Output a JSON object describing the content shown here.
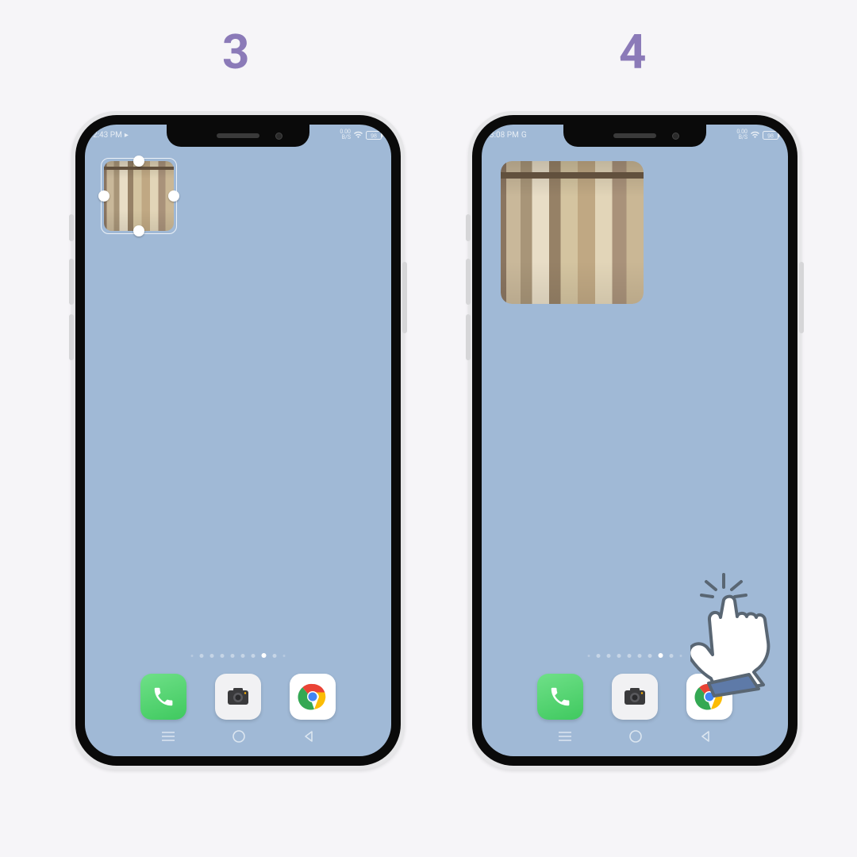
{
  "steps": {
    "left": {
      "label": "3"
    },
    "right": {
      "label": "4"
    }
  },
  "phone_left": {
    "status": {
      "time": "2:43 PM",
      "extra": "▸",
      "rate": "0.00",
      "rate2": "B/S",
      "battery": "98"
    },
    "widget": {
      "name": "photo-widget",
      "state": "editing"
    },
    "dock": {
      "phone": "Phone",
      "camera": "Camera",
      "chrome": "Chrome"
    },
    "page_count": 9,
    "current_page": 7
  },
  "phone_right": {
    "status": {
      "time": "3:08 PM",
      "extra": "G",
      "rate": "0.00",
      "rate2": "B/S",
      "battery": "98"
    },
    "widget": {
      "name": "photo-widget",
      "state": "placed"
    },
    "dock": {
      "phone": "Phone",
      "camera": "Camera",
      "chrome": "Chrome"
    },
    "page_count": 9,
    "current_page": 7
  },
  "colors": {
    "bg": "#f6f5f8",
    "step_label": "#8b7ab8",
    "wallpaper": "#a0b9d6",
    "frame": "#0a0a0a"
  },
  "icons": {
    "phone": "phone-icon",
    "camera": "camera-icon",
    "chrome": "chrome-icon",
    "wifi": "wifi-icon",
    "battery": "battery-icon",
    "nav_menu": "menu-icon",
    "nav_home": "circle-icon",
    "nav_back": "triangle-left-icon",
    "tap": "tap-hand-icon"
  }
}
